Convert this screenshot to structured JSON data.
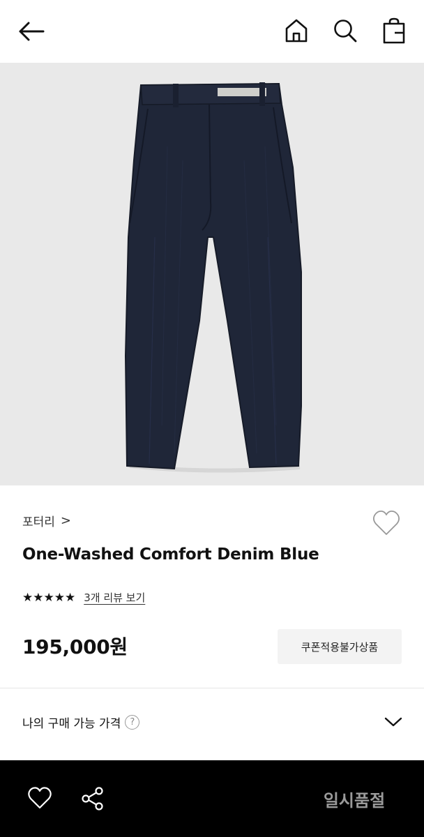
{
  "header": {
    "back_icon": "arrow-left-icon",
    "home_icon": "home-icon",
    "search_icon": "search-icon",
    "cart_icon": "shopping-bag-icon"
  },
  "product": {
    "image_alt": "navy denim pants",
    "brand": "포터리",
    "brand_chevron": ">",
    "name": "One-Washed Comfort Denim Blue",
    "stars": "★★★★★",
    "rating_value": 5,
    "rating_max": 5,
    "review_link": "3개 리뷰 보기",
    "price": "195,000원",
    "coupon_label": "쿠폰적용불가상품"
  },
  "my_price": {
    "label": "나의 구매 가능 가격",
    "help": "?"
  },
  "bottom_bar": {
    "sold_out_label": "일시품절",
    "heart_icon": "heart-icon",
    "share_icon": "share-icon"
  },
  "colors": {
    "hero_bg": "#e9e9e9",
    "denim": "#1f2638",
    "bottom_bar": "#000000",
    "sold_out_text": "#9a9a9a",
    "coupon_bg": "#f3f3f3"
  }
}
